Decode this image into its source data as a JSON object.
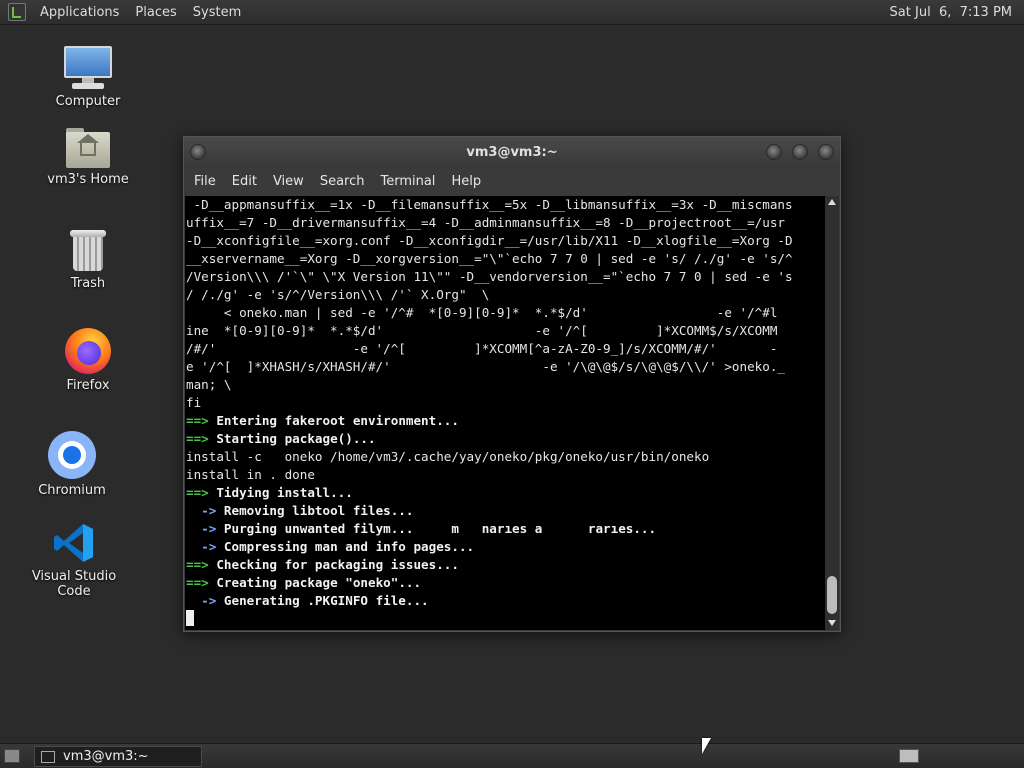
{
  "top_panel": {
    "menus": [
      "Applications",
      "Places",
      "System"
    ],
    "clock": "Sat Jul  6,  7:13 PM"
  },
  "desktop_icons": {
    "computer": "Computer",
    "home": "vm3's Home",
    "trash": "Trash",
    "firefox": "Firefox",
    "chromium": "Chromium",
    "vscode": "Visual Studio Code"
  },
  "terminal": {
    "title": "vm3@vm3:~",
    "menu": [
      "File",
      "Edit",
      "View",
      "Search",
      "Terminal",
      "Help"
    ],
    "lines": [
      {
        "text": " -D__appmansuffix__=1x -D__filemansuffix__=5x -D__libmansuffix__=3x -D__miscmans"
      },
      {
        "text": "uffix__=7 -D__drivermansuffix__=4 -D__adminmansuffix__=8 -D__projectroot__=/usr"
      },
      {
        "text": "-D__xconfigfile__=xorg.conf -D__xconfigdir__=/usr/lib/X11 -D__xlogfile__=Xorg -D"
      },
      {
        "text": "__xservername__=Xorg -D__xorgversion__=\"\\\"`echo 7 7 0 | sed -e 's/ /./g' -e 's/^"
      },
      {
        "text": "/Version\\\\\\ /'`\\\" \\\"X Version 11\\\"\" -D__vendorversion__=\"`echo 7 7 0 | sed -e 's"
      },
      {
        "text": "/ /./g' -e 's/^/Version\\\\\\ /'` X.Org\"  \\"
      },
      {
        "text": "     < oneko.man | sed -e '/^#  *[0-9][0-9]*  *.*$/d'                 -e '/^#l"
      },
      {
        "text": "ine  *[0-9][0-9]*  *.*$/d'                    -e '/^[         ]*XCOMM$/s/XCOMM"
      },
      {
        "text": "/#/'                  -e '/^[         ]*XCOMM[^a-zA-Z0-9_]/s/XCOMM/#/'       -"
      },
      {
        "text": "e '/^[  ]*XHASH/s/XHASH/#/'                    -e '/\\@\\@$/s/\\@\\@$/\\\\/' >oneko._"
      },
      {
        "text": "man; \\"
      },
      {
        "text": "fi"
      },
      {
        "prefix": "==> ",
        "text": "Entering fakeroot environment...",
        "style": "g"
      },
      {
        "prefix": "==> ",
        "text": "Starting package()...",
        "style": "g"
      },
      {
        "text": "install -c   oneko /home/vm3/.cache/yay/oneko/pkg/oneko/usr/bin/oneko"
      },
      {
        "text": "install in . done"
      },
      {
        "prefix": "==> ",
        "text": "Tidying install...",
        "style": "g"
      },
      {
        "prefix": "  -> ",
        "text": "Removing libtool files...",
        "style": "b"
      },
      {
        "prefix": "  -> ",
        "text": "Purging unwanted filym...     m   narıes a      rarıes...",
        "style": "b"
      },
      {
        "prefix": "  -> ",
        "text": "Compressing man and info pages...",
        "style": "b"
      },
      {
        "prefix": "==> ",
        "text": "Checking for packaging issues...",
        "style": "g"
      },
      {
        "prefix": "==> ",
        "text": "Creating package \"oneko\"...",
        "style": "g"
      },
      {
        "prefix": "  -> ",
        "text": "Generating .PKGINFO file...",
        "style": "b"
      }
    ]
  },
  "bottom_panel": {
    "task": "vm3@vm3:~"
  },
  "colors": {
    "arrow_green": "#4ec24e",
    "arrow_blue": "#7aa7ff",
    "terminal_bg": "#000000",
    "desktop_bg": "#2b2b2b"
  }
}
